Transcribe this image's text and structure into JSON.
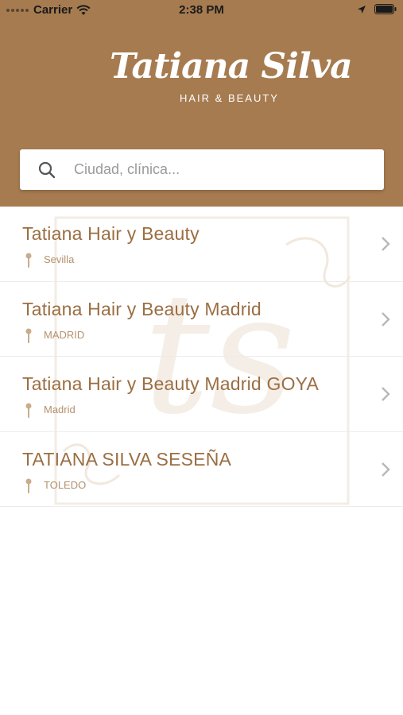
{
  "status_bar": {
    "carrier": "Carrier",
    "time": "2:38 PM",
    "icons": [
      "signal-dots-icon",
      "wifi-icon",
      "location-arrow-icon",
      "battery-icon"
    ]
  },
  "brand": {
    "name": "Tatiana Silva",
    "tagline": "HAIR & BEAUTY",
    "colors": {
      "header": "#a67b50",
      "title_text": "#9b6e42",
      "location_text": "#b3916d"
    }
  },
  "search": {
    "placeholder": "Ciudad, clínica..."
  },
  "clinics": [
    {
      "name": "Tatiana Hair y Beauty",
      "location": "Sevilla"
    },
    {
      "name": "Tatiana Hair y Beauty Madrid",
      "location": "MADRID"
    },
    {
      "name": "Tatiana Hair y Beauty Madrid GOYA",
      "location": "Madrid"
    },
    {
      "name": "TATIANA SILVA SESEÑA",
      "location": "TOLEDO"
    }
  ]
}
